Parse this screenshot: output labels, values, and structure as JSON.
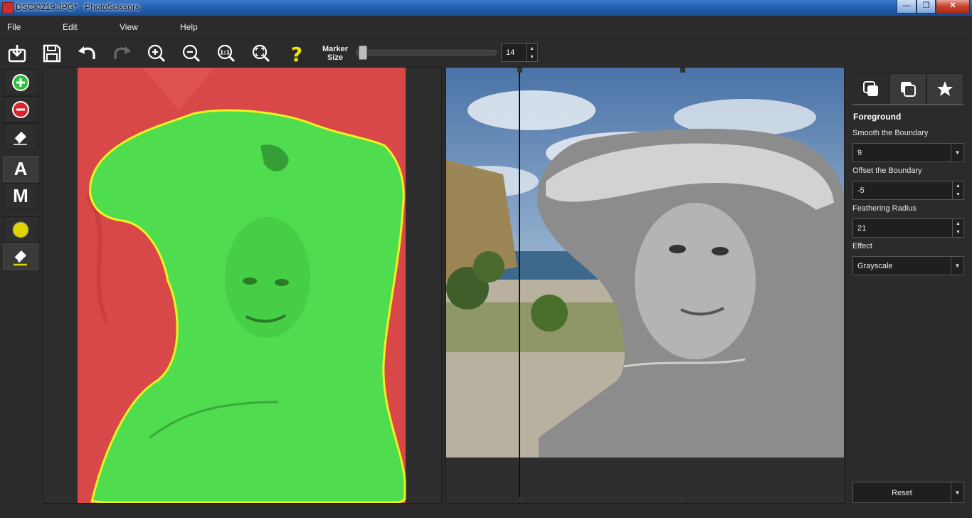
{
  "window": {
    "title": "DSCI0219.JPG* - PhotoScissors",
    "minimize": "—",
    "maximize": "❐",
    "close": "✕"
  },
  "menu": [
    "File",
    "Edit",
    "View",
    "Help"
  ],
  "toolbar": {
    "icons": [
      "open-icon",
      "save-icon",
      "undo-icon",
      "redo-icon",
      "zoom-in-icon",
      "zoom-out-icon",
      "actual-size-icon",
      "fit-to-window-icon",
      "help-icon"
    ],
    "marker_size_label": "Marker Size",
    "marker_size_value": "14",
    "marker_size_slider_fraction": 0.02
  },
  "tools": {
    "letter_auto": "A",
    "letter_manual": "M",
    "icons": [
      "foreground-marker-icon",
      "background-marker-icon",
      "eraser-icon",
      "auto-mode",
      "manual-mode",
      "boundary-marker-icon",
      "boundary-eraser-icon"
    ]
  },
  "panel": {
    "tabs": [
      "foreground-tab",
      "background-tab",
      "effects-tab"
    ],
    "section_title": "Foreground",
    "smooth_label": "Smooth the Boundary",
    "smooth_value": "9",
    "offset_label": "Offset the Boundary",
    "offset_value": "-5",
    "feather_label": "Feathering Radius",
    "feather_value": "21",
    "effect_label": "Effect",
    "effect_value": "Grayscale",
    "reset_label": "Reset"
  },
  "colors": {
    "foreground_marker": "#3cdc3c",
    "background_marker": "#e04848",
    "boundary": "#f0f020",
    "help_icon": "#f2e600"
  }
}
